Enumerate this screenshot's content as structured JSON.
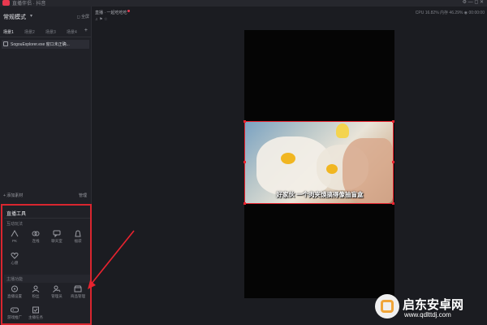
{
  "titlebar": {
    "app_name": "直播伴侣 · 抖音",
    "window_controls": "⚙ — ◻ ✕"
  },
  "left_panel": {
    "mode_title": "常规模式",
    "mode_caret": "▾",
    "mode_right": "◻ 全屏",
    "scene_tabs": [
      {
        "label": "场景1",
        "active": true
      },
      {
        "label": "场景2",
        "active": false
      },
      {
        "label": "场景3",
        "active": false
      },
      {
        "label": "场景4",
        "active": false
      }
    ],
    "scene_add": "+",
    "sources": [
      {
        "label": "SogouExplorer.exe 窗口未正确..."
      }
    ],
    "add_source": "+ 添加素材",
    "manage": "管理"
  },
  "tools_panel": {
    "title": "直播工具",
    "section_interactive": "互动玩法",
    "section_anchor": "主播功能",
    "row1": [
      {
        "label": "PK",
        "icon": "pk-icon"
      },
      {
        "label": "连线",
        "icon": "link-icon"
      },
      {
        "label": "聊天室",
        "icon": "chat-icon"
      },
      {
        "label": "福袋",
        "icon": "lucky-bag-icon"
      }
    ],
    "row2": [
      {
        "label": "心愿",
        "icon": "wish-icon"
      }
    ],
    "row3": [
      {
        "label": "直播设置",
        "icon": "live-settings-icon"
      },
      {
        "label": "粉丝",
        "icon": "fans-icon"
      },
      {
        "label": "管理员",
        "icon": "admin-icon"
      },
      {
        "label": "商品管理",
        "icon": "shop-icon"
      }
    ],
    "row4": [
      {
        "label": "游戏推广",
        "icon": "gamepad-icon"
      },
      {
        "label": "主播任务",
        "icon": "task-icon"
      }
    ]
  },
  "center_header": {
    "title": "直播 · 一起吃吃吃",
    "subtitle": "♫ ⚑ ☆",
    "stats": "CPU 16.82%   内存 46.29%   ◉ 00:00:00"
  },
  "video": {
    "caption": "好家伙 一个肉夹馍搞得像抽盲盒"
  },
  "watermark": {
    "name": "启东安卓网",
    "url": "www.qdlttdj.com"
  },
  "colors": {
    "accent_red": "#e8232f",
    "panel_bg": "#202127",
    "canvas_bg": "#050505"
  }
}
